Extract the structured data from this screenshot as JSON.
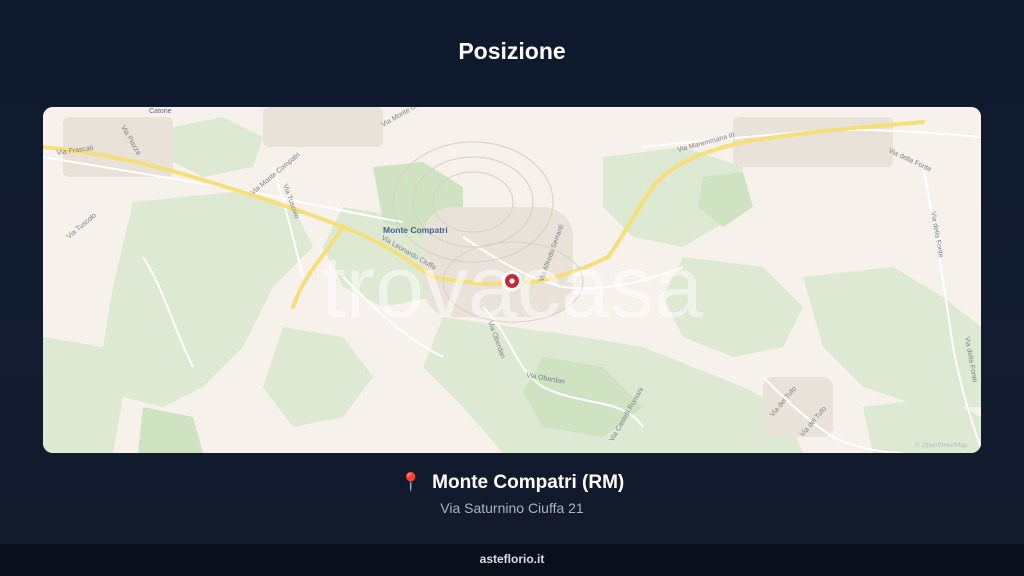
{
  "header": {
    "title": "Posizione"
  },
  "map": {
    "watermark": "trovacasa",
    "attribution": "© OpenStreetMap",
    "labels": {
      "town": "Monte Compatri",
      "catone": "Catone",
      "via_frascati": "Via Frascati",
      "via_monte_compatri": "Via Monte Compatri",
      "via_monte_compatri_2": "Via Monte Compatri",
      "via_tuscolo": "Via Tuscolo",
      "via_tuscolo_2": "Via Tuscolo",
      "via_piazza": "Via Piazza",
      "via_leonardo_ciuffa": "Via Leonardo Ciuffa",
      "via_alfredo_serranti": "Via Alfredo Serranti",
      "via_maremmana": "Via Maremmana III",
      "via_della_fonte": "Via della Fonte",
      "via_della_fonte_2": "Via della Fonte",
      "via_della_fonte_3": "Via della Fonte",
      "via_oberdan": "Via Oberdan",
      "via_oberdan_2": "Via Oberdan",
      "via_castelli_romani": "Via Castelli Romani",
      "via_del_tufo": "Via del Tufo",
      "via_del_tufo_2": "Via del Tufo"
    },
    "marker_color": "#c8283c"
  },
  "location": {
    "pin_icon": "📍",
    "name": "Monte Compatri (RM)",
    "address": "Via Saturnino Ciuffa 21"
  },
  "footer": {
    "site": "asteflorio.it"
  }
}
